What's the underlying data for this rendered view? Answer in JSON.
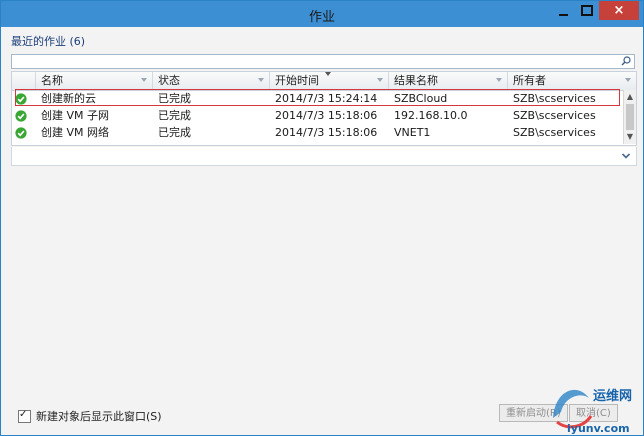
{
  "window": {
    "title": "作业",
    "minimize_label": "",
    "maximize_label": "",
    "close_label": "×"
  },
  "recent": {
    "label": "最近的作业 (6)"
  },
  "search": {
    "placeholder": ""
  },
  "grid": {
    "columns": [
      "名称",
      "状态",
      "开始时间",
      "结果名称",
      "所有者"
    ],
    "rows": [
      {
        "name": "创建新的云",
        "status": "已完成",
        "start": "2014/7/3 15:24:14",
        "result": "SZBCloud",
        "owner": "SZB\\scservices"
      },
      {
        "name": "创建 VM 子网",
        "status": "已完成",
        "start": "2014/7/3 15:18:06",
        "result": "192.168.10.0",
        "owner": "SZB\\scservices"
      },
      {
        "name": "创建 VM 网络",
        "status": "已完成",
        "start": "2014/7/3 15:18:06",
        "result": "VNET1",
        "owner": "SZB\\scservices"
      }
    ]
  },
  "footer": {
    "checkbox_label": "新建对象后显示此窗口(S)",
    "checked": true,
    "restart_label": "重新启动(R)",
    "cancel_label": "取消(C)"
  },
  "watermark": {
    "cn": "运维网",
    "en": "iyunv.com"
  },
  "colors": {
    "titlebar": "#3c8fd3",
    "close": "#c7413b",
    "selection_outline": "#d4373c",
    "success": "#3aa735"
  }
}
